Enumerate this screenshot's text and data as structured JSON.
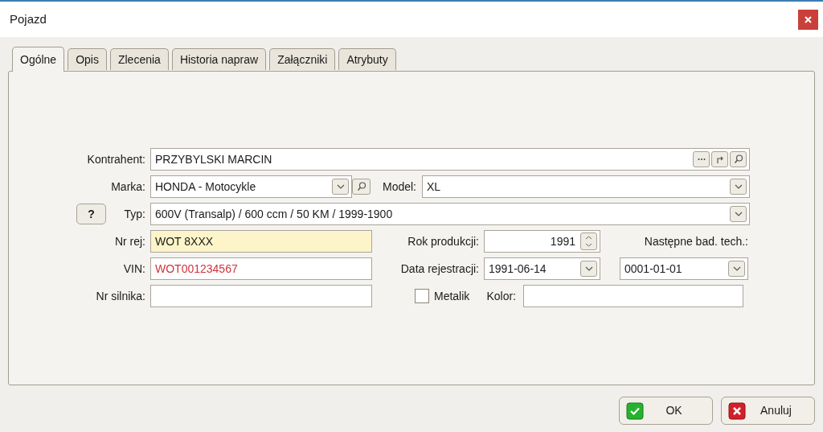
{
  "window": {
    "title": "Pojazd"
  },
  "tabs": [
    {
      "label": "Ogólne",
      "selected": true
    },
    {
      "label": "Opis",
      "selected": false
    },
    {
      "label": "Zlecenia",
      "selected": false
    },
    {
      "label": "Historia napraw",
      "selected": false
    },
    {
      "label": "Załączniki",
      "selected": false
    },
    {
      "label": "Atrybuty",
      "selected": false
    }
  ],
  "form": {
    "kontrahent": {
      "label": "Kontrahent:",
      "value": "PRZYBYLSKI MARCIN"
    },
    "marka": {
      "label": "Marka:",
      "value": "HONDA - Motocykle"
    },
    "model": {
      "label": "Model:",
      "value": "XL"
    },
    "help_button": "?",
    "typ": {
      "label": "Typ:",
      "value": "600V (Transalp) / 600 ccm / 50 KM / 1999-1900"
    },
    "nr_rej": {
      "label": "Nr rej:",
      "value": "WOT 8XXX",
      "highlighted": true
    },
    "rok_produkcji": {
      "label": "Rok produkcji:",
      "value": "1991"
    },
    "nastepne_badanie": {
      "label": "Następne bad. tech.:",
      "value": "0001-01-01"
    },
    "vin": {
      "label": "VIN:",
      "value": "WOT001234567",
      "invalid": true
    },
    "data_rejestracji": {
      "label": "Data rejestracji:",
      "value": "1991-06-14"
    },
    "nr_silnika": {
      "label": "Nr silnika:"
    },
    "metalik": {
      "label": "Metalik",
      "checked": false
    },
    "kolor": {
      "label": "Kolor:"
    }
  },
  "buttons": [
    {
      "label": "OK",
      "kind": "ok"
    },
    {
      "label": "Anuluj",
      "kind": "cancel"
    }
  ]
}
